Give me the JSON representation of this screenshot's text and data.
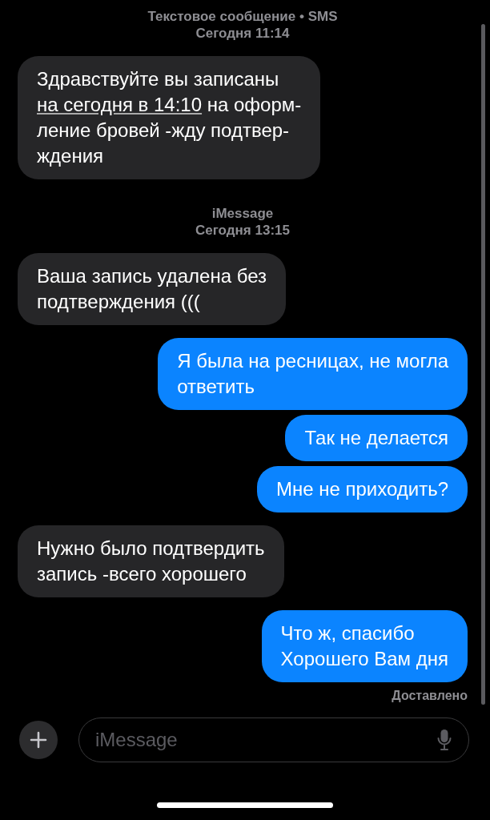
{
  "thread": [
    {
      "kind": "timestamp",
      "service": "Текстовое сообщение • SMS",
      "time": "Сегодня 11:14"
    },
    {
      "kind": "incoming",
      "segments": [
        {
          "text": "Здравствуйте вы записаны\n",
          "link": false
        },
        {
          "text": "на сегодня в 14:10",
          "link": true
        },
        {
          "text": " на оформ-\nление бровей -жду подтвер-\nждения",
          "link": false
        }
      ]
    },
    {
      "kind": "timestamp",
      "service": "iMessage",
      "time": "Сегодня 13:15"
    },
    {
      "kind": "incoming",
      "segments": [
        {
          "text": "Ваша запись удалена без\nподтверждения (((",
          "link": false
        }
      ]
    },
    {
      "kind": "outgoing",
      "segments": [
        {
          "text": "Я была на ресницах, не могла\nответить",
          "link": false
        }
      ]
    },
    {
      "kind": "outgoing",
      "segments": [
        {
          "text": "Так не делается",
          "link": false
        }
      ]
    },
    {
      "kind": "outgoing",
      "segments": [
        {
          "text": "Мне не приходить?",
          "link": false
        }
      ]
    },
    {
      "kind": "incoming",
      "segments": [
        {
          "text": "Нужно было подтвердить\nзапись -всего хорошего",
          "link": false
        }
      ]
    },
    {
      "kind": "outgoing",
      "segments": [
        {
          "text": "Что ж, спасибо\nХорошего Вам дня",
          "link": false
        }
      ]
    }
  ],
  "delivery_status": "Доставлено",
  "compose": {
    "placeholder": "iMessage"
  }
}
